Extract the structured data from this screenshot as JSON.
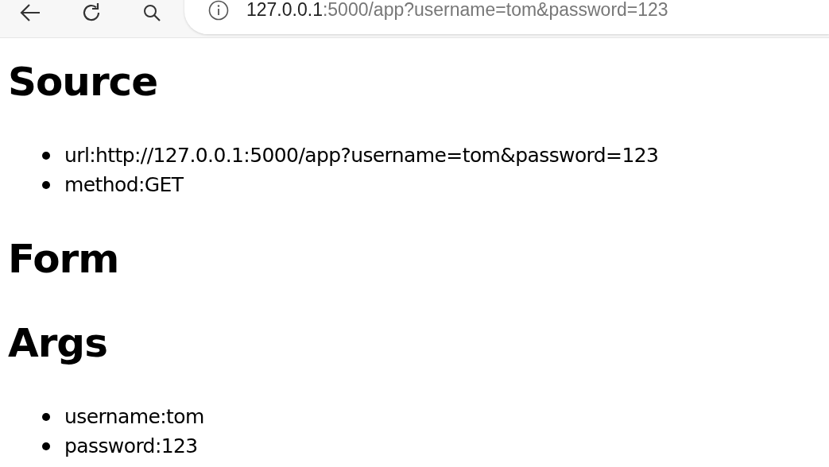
{
  "address_bar": {
    "host": "127.0.0.1",
    "path": ":5000/app?username=tom&password=123"
  },
  "sections": [
    {
      "heading": "Source",
      "items": [
        "url:http://127.0.0.1:5000/app?username=tom&password=123",
        "method:GET"
      ]
    },
    {
      "heading": "Form"
    },
    {
      "heading": "Args",
      "items": [
        "username:tom",
        "password:123"
      ]
    }
  ]
}
